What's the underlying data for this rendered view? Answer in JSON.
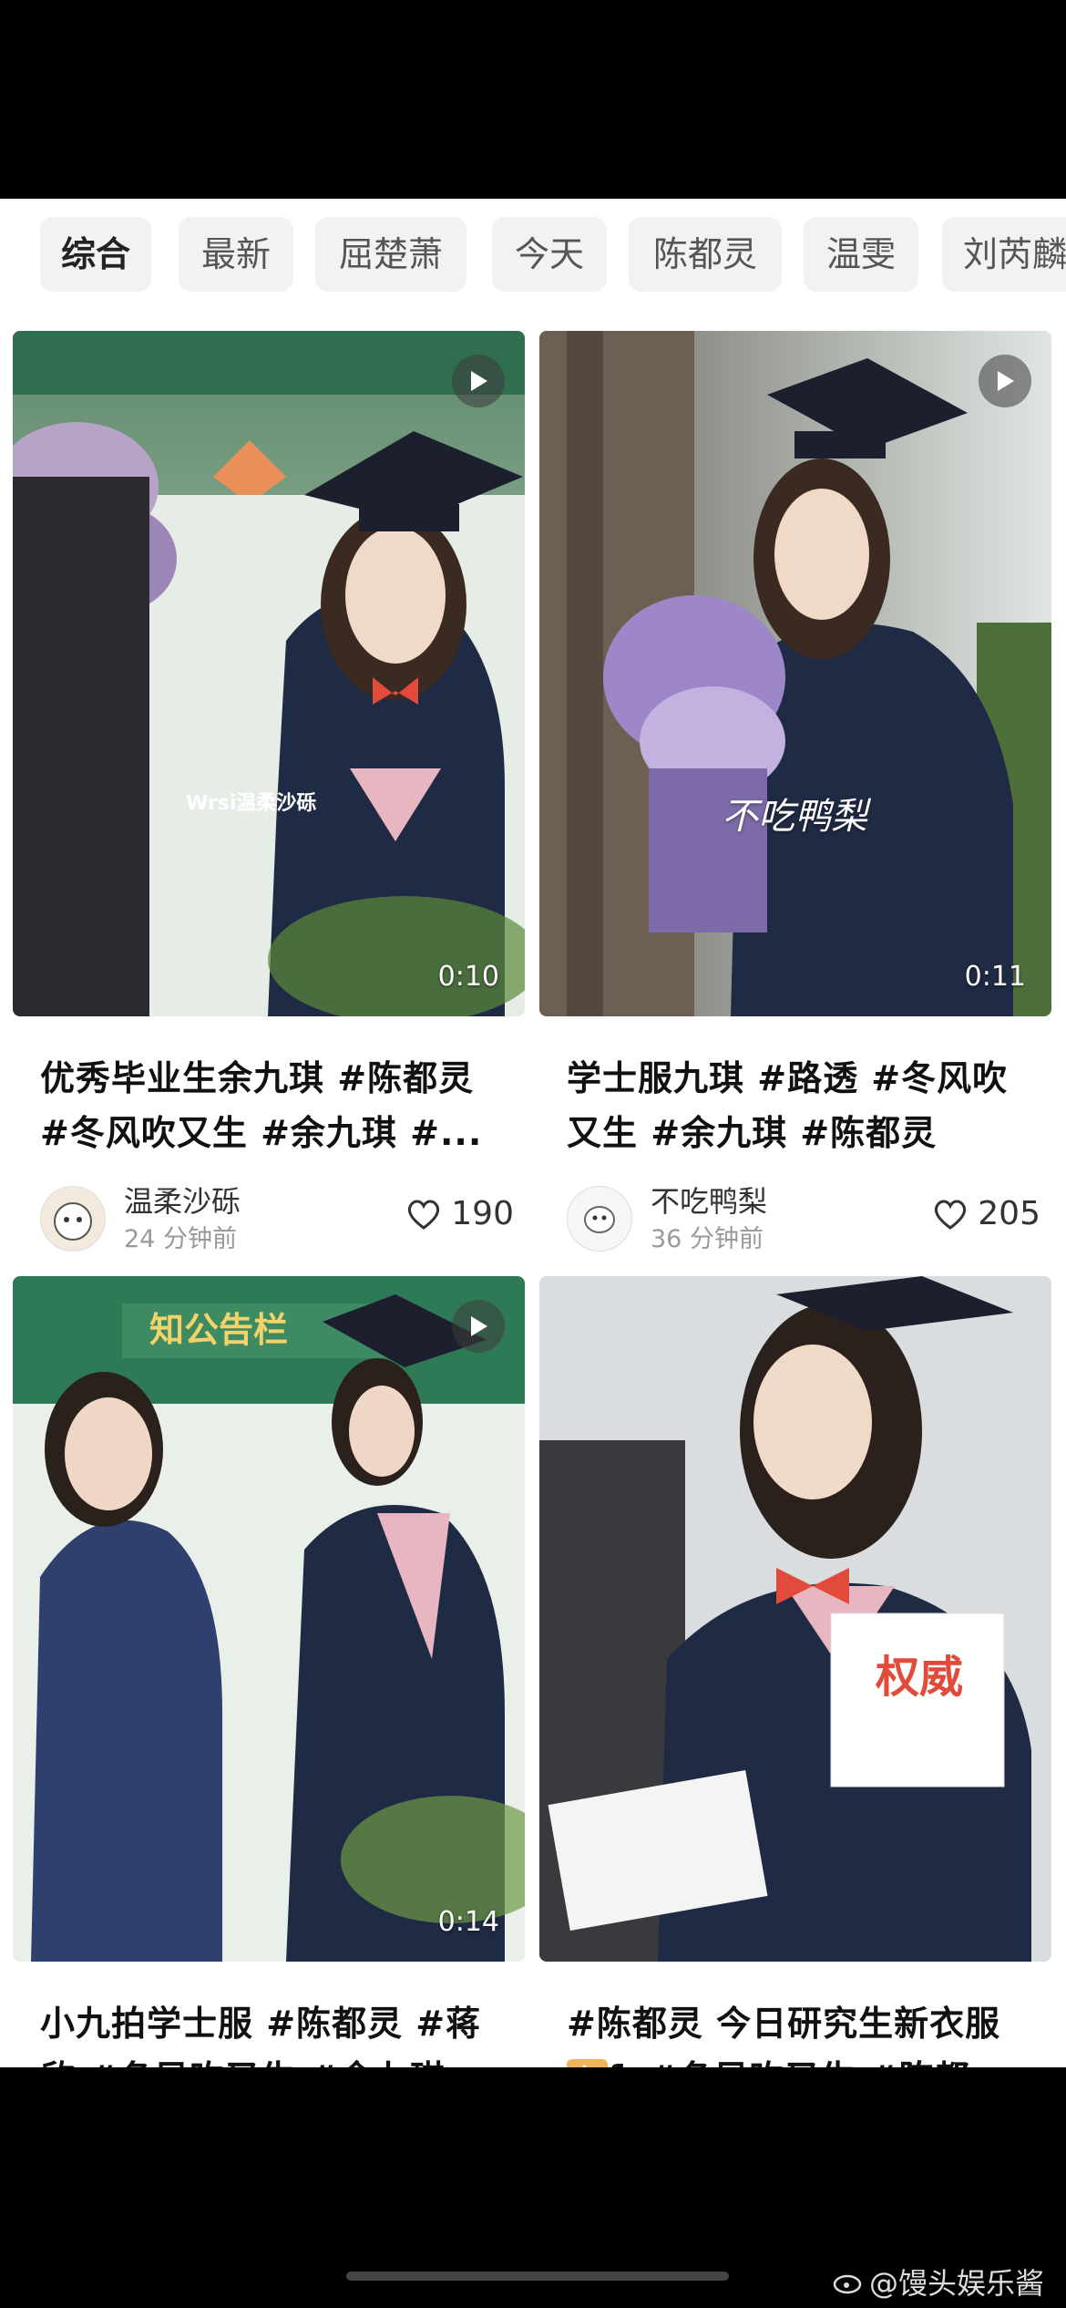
{
  "tabs": [
    "综合",
    "最新",
    "屈楚萧",
    "今天",
    "陈都灵",
    "温雯",
    "刘芮麟"
  ],
  "cards": [
    {
      "duration": "0:10",
      "caption_line1": "优秀毕业生余九琪 #陈都灵",
      "caption_line2": "#冬风吹又生  #余九琪  #...",
      "author": "温柔沙砾",
      "time": "24 分钟前",
      "likes": "190",
      "image_overlay_text": "Wrsi温柔沙砾"
    },
    {
      "duration": "0:11",
      "caption_line1": "学士服九琪  #路透  #冬风吹",
      "caption_line2": "又生  #余九琪  #陈都灵",
      "author": "不吃鸭梨",
      "time": "36 分钟前",
      "likes": "205",
      "image_overlay_text": "不吃鸭梨"
    },
    {
      "duration": "0:14",
      "caption_line1": "小九拍学士服  #陈都灵  #蒋",
      "caption_line2": "欣  #冬风吹又生  #余九琪",
      "image_overlay_text": "知公告栏"
    },
    {
      "caption_line1": "#陈都灵  今日研究生新衣服",
      "caption_badge": "有",
      "caption_line2": "fo#冬风吹又生  #陈都...",
      "image_overlay_text": "权威"
    }
  ],
  "watermark": "@馒头娱乐酱",
  "colors": {
    "accent": "#e24a3b",
    "gown": "#1f2a44",
    "bg_tab": "#f2f2f2"
  }
}
